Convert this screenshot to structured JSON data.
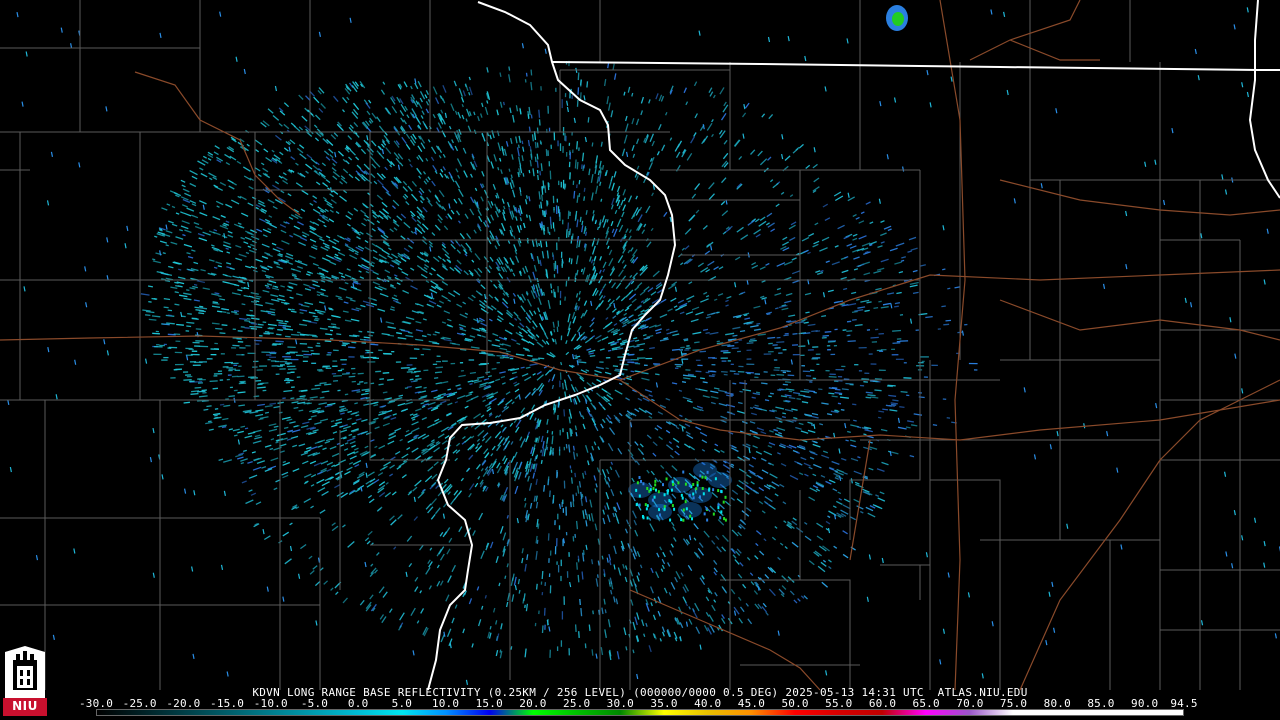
{
  "product": {
    "caption": "KDVN LONG RANGE BASE REFLECTIVITY (0.25KM / 256 LEVEL) (000000/0000 0.5 DEG) 2025-05-13 14:31 UTC  ATLAS.NIU.EDU",
    "site": "KDVN",
    "logo_text": "NIU"
  },
  "legend": {
    "ticks": [
      "-30.0",
      "-25.0",
      "-20.0",
      "-15.0",
      "-10.0",
      "-5.0",
      "0.0",
      "5.0",
      "10.0",
      "15.0",
      "20.0",
      "25.0",
      "30.0",
      "35.0",
      "40.0",
      "45.0",
      "50.0",
      "55.0",
      "60.0",
      "65.0",
      "70.0",
      "75.0",
      "80.0",
      "85.0",
      "90.0",
      "94.5"
    ],
    "tick_values": [
      -30,
      -25,
      -20,
      -15,
      -10,
      -5,
      0,
      5,
      10,
      15,
      20,
      25,
      30,
      35,
      40,
      45,
      50,
      55,
      60,
      65,
      70,
      75,
      80,
      85,
      90,
      94.5
    ],
    "range": [
      -30,
      94.5
    ],
    "colors": [
      {
        "value": -30,
        "color": "#000000"
      },
      {
        "value": 0,
        "color": "#00bcd4"
      },
      {
        "value": 5,
        "color": "#00e5ee"
      },
      {
        "value": 10,
        "color": "#0090ff"
      },
      {
        "value": 15,
        "color": "#0000f0"
      },
      {
        "value": 20,
        "color": "#00ff00"
      },
      {
        "value": 25,
        "color": "#00c000"
      },
      {
        "value": 30,
        "color": "#008800"
      },
      {
        "value": 35,
        "color": "#ffff00"
      },
      {
        "value": 40,
        "color": "#e7c000"
      },
      {
        "value": 45,
        "color": "#ff9000"
      },
      {
        "value": 50,
        "color": "#ff0000"
      },
      {
        "value": 55,
        "color": "#d60000"
      },
      {
        "value": 60,
        "color": "#c00000"
      },
      {
        "value": 65,
        "color": "#ff00ff"
      },
      {
        "value": 70,
        "color": "#9955c9"
      },
      {
        "value": 75,
        "color": "#ffffff"
      },
      {
        "value": 94.5,
        "color": "#ffffff"
      }
    ]
  },
  "colors": {
    "background": "#000000",
    "county_lines": "#5a5a5a",
    "state_lines": "#ffffff",
    "highways": "#8a4a2a",
    "echo_light": "#1fc8d8",
    "echo_blue": "#2a7fe0",
    "echo_green": "#22dd22"
  }
}
